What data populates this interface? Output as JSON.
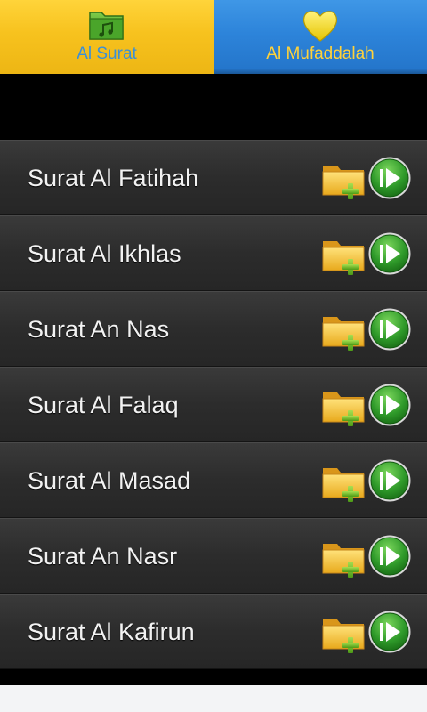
{
  "tabs": [
    {
      "label": "Al Surat",
      "icon": "music-folder-icon",
      "active": true
    },
    {
      "label": "Al Mufaddalah",
      "icon": "heart-icon",
      "active": false
    }
  ],
  "surahs": [
    {
      "title": "Surat Al Fatihah"
    },
    {
      "title": "Surat Al Ikhlas"
    },
    {
      "title": "Surat An Nas"
    },
    {
      "title": "Surat Al Falaq"
    },
    {
      "title": "Surat Al Masad"
    },
    {
      "title": "Surat An Nasr"
    },
    {
      "title": "Surat Al Kafirun"
    }
  ],
  "row_actions": {
    "add_icon": "add-to-folder-icon",
    "play_icon": "play-icon"
  },
  "colors": {
    "tab_active_bg": "#f7c21e",
    "tab_inactive_bg": "#2d84da",
    "tab_active_text": "#3a8fd8",
    "tab_inactive_text": "#ffd23a",
    "row_text": "#f2f2f2",
    "play_green": "#2f9a2a",
    "folder_yellow": "#f4c430"
  }
}
